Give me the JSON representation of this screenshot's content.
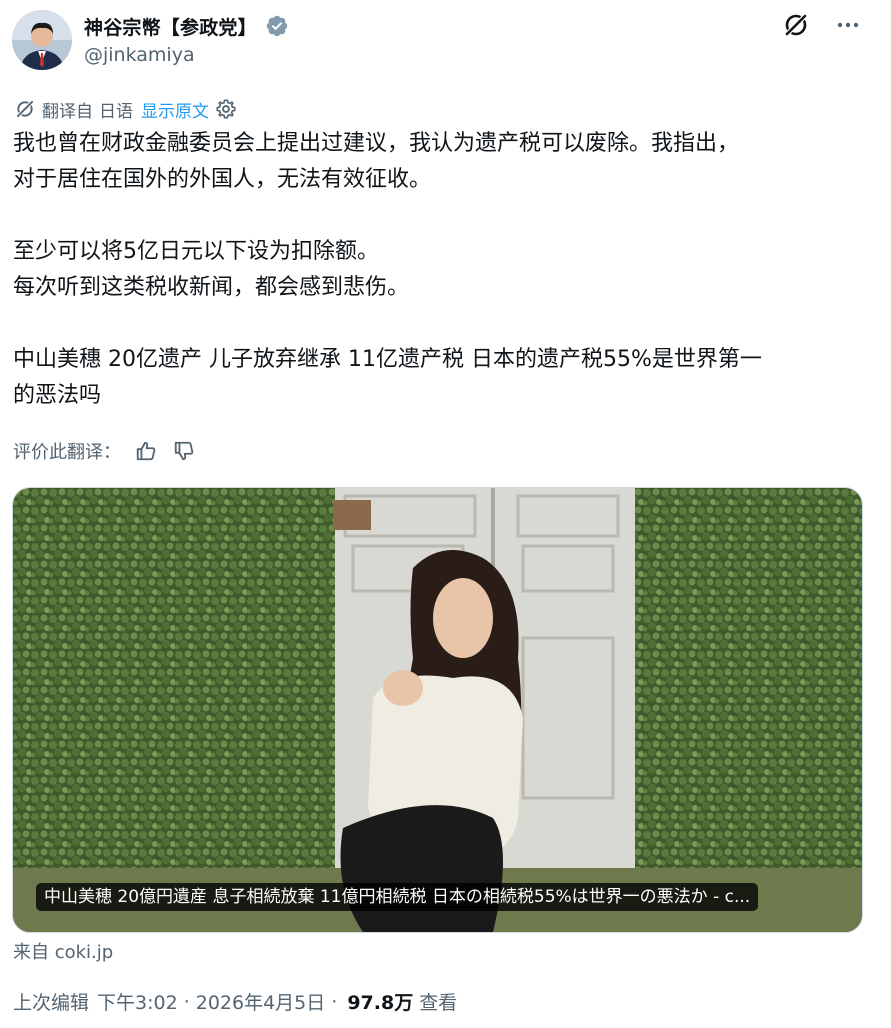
{
  "author": {
    "display_name": "神谷宗幣【参政党】",
    "handle": "@jinkamiya",
    "verified_badge_color": "#829aab",
    "avatar_icon": "user-avatar"
  },
  "top_actions": {
    "grok_icon": "grok-icon",
    "more_icon": "more-icon"
  },
  "translation": {
    "translated_from": "翻译自",
    "language": "日语",
    "show_original": "显示原文",
    "link_color": "#1d9bf0"
  },
  "body": {
    "line1": "我也曾在财政金融委员会上提出过建议，我认为遗产税可以废除。我指出，",
    "line2": "对于居住在国外的外国人，无法有效征收。",
    "line3": "至少可以将5亿日元以下设为扣除额。",
    "line4": "每次听到这类税收新闻，都会感到悲伤。",
    "line5": "中山美穗 20亿遗产 儿子放弃继承 11亿遗产税 日本的遗产税55%是世界第一",
    "line6": "的恶法吗"
  },
  "rating": {
    "label": "评价此翻译：",
    "thumbs_up_icon": "thumbs-up-icon",
    "thumbs_down_icon": "thumbs-down-icon"
  },
  "card": {
    "caption": "中山美穂 20億円遺産 息子相続放棄 11億円相続税 日本の相続税55%は世界一の悪法か - c...",
    "source": "来自 coki.jp"
  },
  "meta": {
    "edited_prefix": "上次编辑",
    "time": "下午3:02",
    "date": "2026年4月5日",
    "views_count": "97.8万",
    "views_label": "查看"
  }
}
